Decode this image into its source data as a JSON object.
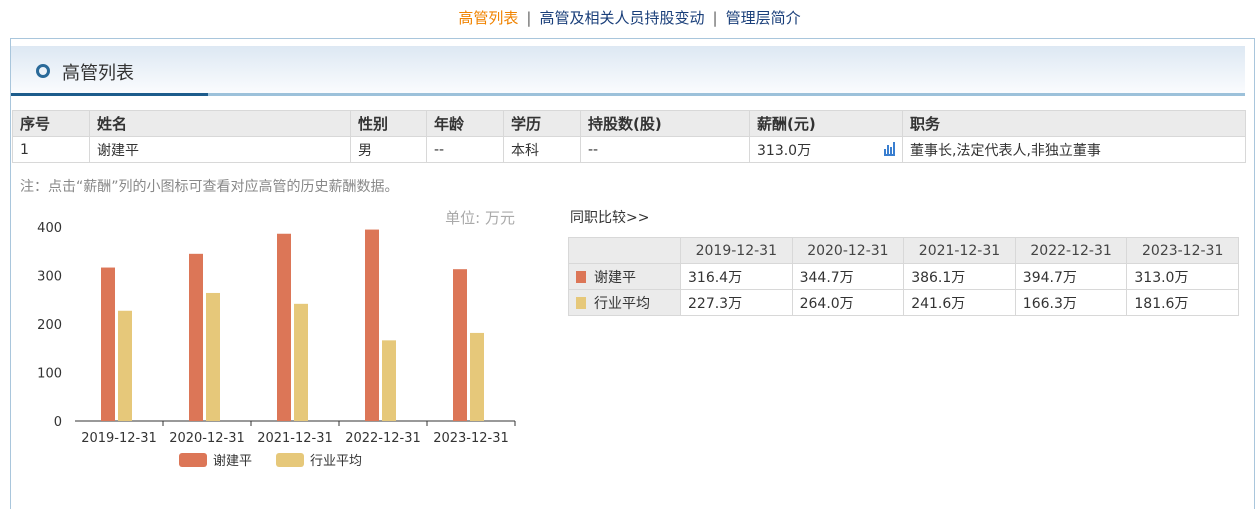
{
  "nav": {
    "items": [
      "高管列表",
      "高管及相关人员持股变动",
      "管理层简介"
    ],
    "sep": "|"
  },
  "section": {
    "title": "高管列表"
  },
  "table": {
    "headers": [
      "序号",
      "姓名",
      "性别",
      "年龄",
      "学历",
      "持股数(股)",
      "薪酬(元)",
      "职务"
    ],
    "rows": [
      [
        "1",
        "谢建平",
        "男",
        "--",
        "本科",
        "--",
        "313.0万",
        "董事长,法定代表人,非独立董事"
      ]
    ]
  },
  "note": "注：点击“薪酬”列的小图标可查看对应高管的历史薪酬数据。",
  "compare": {
    "title": "同职比较>>",
    "headers": [
      "2019-12-31",
      "2020-12-31",
      "2021-12-31",
      "2022-12-31",
      "2023-12-31"
    ],
    "rows": [
      {
        "label": "谢建平",
        "color": "#dc7657",
        "values": [
          "316.4万",
          "344.7万",
          "386.1万",
          "394.7万",
          "313.0万"
        ]
      },
      {
        "label": "行业平均",
        "color": "#e6c87a",
        "values": [
          "227.3万",
          "264.0万",
          "241.6万",
          "166.3万",
          "181.6万"
        ]
      }
    ]
  },
  "chart_data": {
    "type": "bar",
    "unit_label": "单位: 万元",
    "categories": [
      "2019-12-31",
      "2020-12-31",
      "2021-12-31",
      "2022-12-31",
      "2023-12-31"
    ],
    "series": [
      {
        "name": "谢建平",
        "color": "#dc7657",
        "values": [
          316.4,
          344.7,
          386.1,
          394.7,
          313.0
        ]
      },
      {
        "name": "行业平均",
        "color": "#e6c87a",
        "values": [
          227.3,
          264.0,
          241.6,
          166.3,
          181.6
        ]
      }
    ],
    "yticks": [
      "0",
      "100",
      "200",
      "300",
      "400"
    ],
    "ylim": [
      0,
      400
    ]
  }
}
